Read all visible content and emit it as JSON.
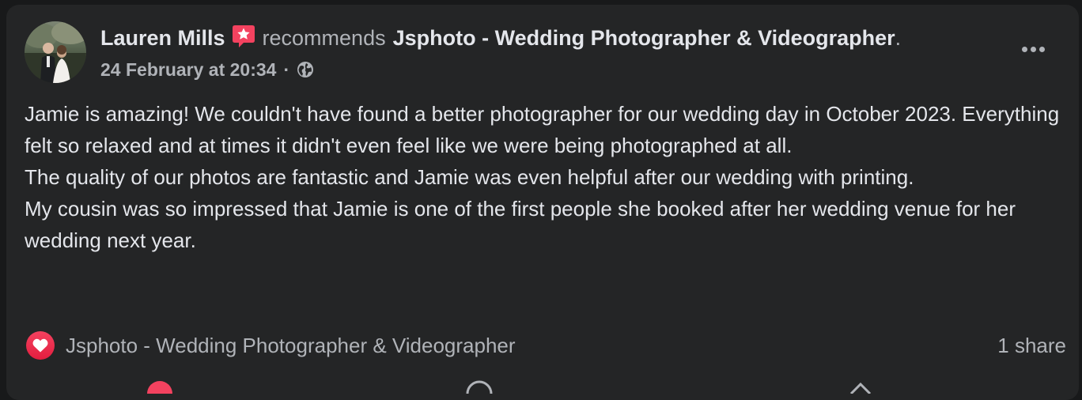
{
  "post": {
    "author": "Lauren Mills",
    "recommends_text": "recommends",
    "page_name": "Jsphoto - Wedding Photographer & Videographer",
    "period": ".",
    "timestamp": "24 February at 20:34",
    "separator": "·",
    "privacy_icon": "globe-icon",
    "more_icon": "more-options-icon",
    "recommend_icon": "recommendation-star-icon",
    "paragraphs": [
      "Jamie is amazing! We couldn't have found a better photographer for our wedding day in October 2023. Everything felt so relaxed and at times it didn't even feel like we were being photographed at all.",
      "The quality of our photos are fantastic and Jamie was even helpful after our wedding with printing.",
      "My cousin was so impressed that Jamie is one of the first people she booked after her wedding venue for her wedding next year."
    ]
  },
  "footer": {
    "reaction_icon": "love-reaction-icon",
    "reactor": "Jsphoto - Wedding Photographer & Videographer",
    "shares": "1 share"
  },
  "colors": {
    "card_bg": "#242526",
    "page_bg": "#18191a",
    "primary_text": "#e4e6eb",
    "secondary_text": "#b0b3b8",
    "recommend_badge": "#f3425f"
  }
}
